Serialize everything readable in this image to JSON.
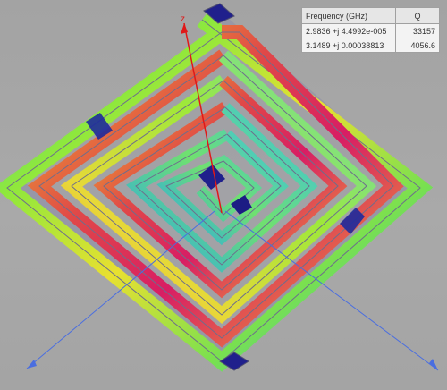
{
  "results": {
    "columns": [
      "Frequency (GHz)",
      "Q"
    ],
    "rows": [
      {
        "frequency": "2.9836 +j 4.4992e-005",
        "q": "33157"
      },
      {
        "frequency": "3.1489 +j 0.00038813",
        "q": "4056.6"
      }
    ]
  },
  "axes": {
    "z_label": "z"
  },
  "colors": {
    "background": "#a8a8a8",
    "trace_outline": "#6e6e8c",
    "field_high": "#e0205a",
    "field_mid_high": "#f0c020",
    "field_mid": "#9ce83a",
    "field_low": "#30c8e8",
    "field_min": "#20208c",
    "axis_red": "#e01818",
    "axis_blue": "#4a6ee0"
  }
}
